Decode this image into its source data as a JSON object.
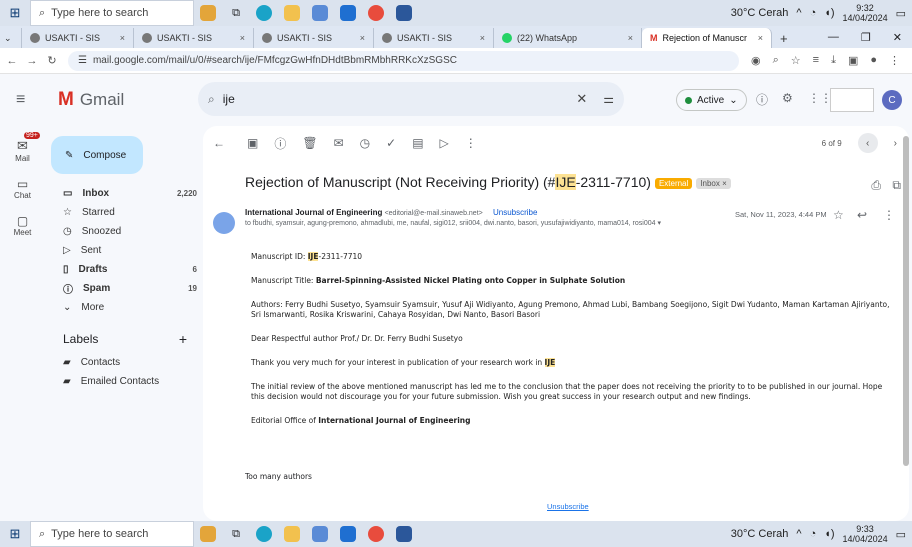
{
  "taskbar_top": {
    "search": "Type here to search",
    "weather": "30°C Cerah",
    "time": "9:32",
    "date": "14/04/2024"
  },
  "taskbar_bottom": {
    "search": "Type here to search",
    "weather": "30°C Cerah",
    "time": "9:33",
    "date": "14/04/2024"
  },
  "tabs": [
    {
      "label": "USAKTI - SIS"
    },
    {
      "label": "USAKTI - SIS"
    },
    {
      "label": "USAKTI - SIS"
    },
    {
      "label": "USAKTI - SIS"
    },
    {
      "label": "(22) WhatsApp"
    },
    {
      "label": "Rejection of Manuscr"
    }
  ],
  "address": {
    "url": "mail.google.com/mail/u/0/#search/ije/FMfcgzGwHfnDHdtBbmRMbhRRKcXzSGSC"
  },
  "gmail": {
    "logo": "Gmail",
    "search_value": "ije",
    "active": "Active"
  },
  "rail": {
    "mail": "Mail",
    "badge": "99+",
    "chat": "Chat",
    "meet": "Meet"
  },
  "sidebar": {
    "compose": "Compose",
    "items": [
      {
        "label": "Inbox",
        "count": "2,220"
      },
      {
        "label": "Starred",
        "count": ""
      },
      {
        "label": "Snoozed",
        "count": ""
      },
      {
        "label": "Sent",
        "count": ""
      },
      {
        "label": "Drafts",
        "count": "6"
      },
      {
        "label": "Spam",
        "count": "19"
      },
      {
        "label": "More",
        "count": ""
      }
    ],
    "labels_title": "Labels",
    "labels": [
      {
        "label": "Contacts"
      },
      {
        "label": "Emailed Contacts"
      }
    ]
  },
  "email": {
    "pager": "6 of 9",
    "subject_pre": "Rejection of Manuscript (Not Receiving Priority) (#",
    "subject_hl": "IJE",
    "subject_post": "-2311-7710)",
    "tag_external": "External",
    "tag_inbox": "Inbox ×",
    "sender_name": "International Journal of Engineering",
    "sender_email": "<editorial@e-mail.sinaweb.net>",
    "unsubscribe": "Unsubscribe",
    "date": "Sat, Nov 11, 2023, 4:44 PM",
    "to": "to fbudhi, syamsuir, agung-premono, ahmadlubi, me, naufal, sigi012, srii004, dwi.nanto, basori, yusufajiwidiyanto, mama014, rosi004 ▾",
    "id_label": "Manuscript ID: ",
    "id_hl": "IJE",
    "id_rest": "-2311-7710",
    "title_label": "Manuscript Title: ",
    "title_value": "Barrel-Spinning-Assisted Nickel Plating onto Copper in Sulphate Solution",
    "authors": "Authors: Ferry Budhi Susetyo, Syamsuir Syamsuir, Yusuf Aji Widiyanto, Agung Premono, Ahmad Lubi, Bambang Soegijono, Sigit Dwi Yudanto, Maman Kartaman Ajiriyanto, Sri Ismarwanti, Rosika Kriswarini, Cahaya Rosyidan, Dwi Nanto, Basori Basori",
    "greeting": "Dear Respectful author Prof./ Dr. Dr. Ferry Budhi Susetyo",
    "thanks_pre": "Thank you very much for your interest in publication of your research work in ",
    "thanks_hl": "IJE",
    "review": "The initial review of the above mentioned manuscript has led me to the conclusion that the paper does not receiving the priority to to be published in our journal. Hope this decision would not discourage you for your future submission. Wish you great success in your research output and new findings.",
    "office_pre": "Editorial Office of ",
    "office_name": "International Journal of Engineering",
    "note": "Too many authors",
    "footer_unsub": "Unsubscribe"
  },
  "colors": {
    "accent": "#0b57d0",
    "compose": "#c2e7ff",
    "highlight": "#fde293",
    "external": "#f9ab00"
  }
}
